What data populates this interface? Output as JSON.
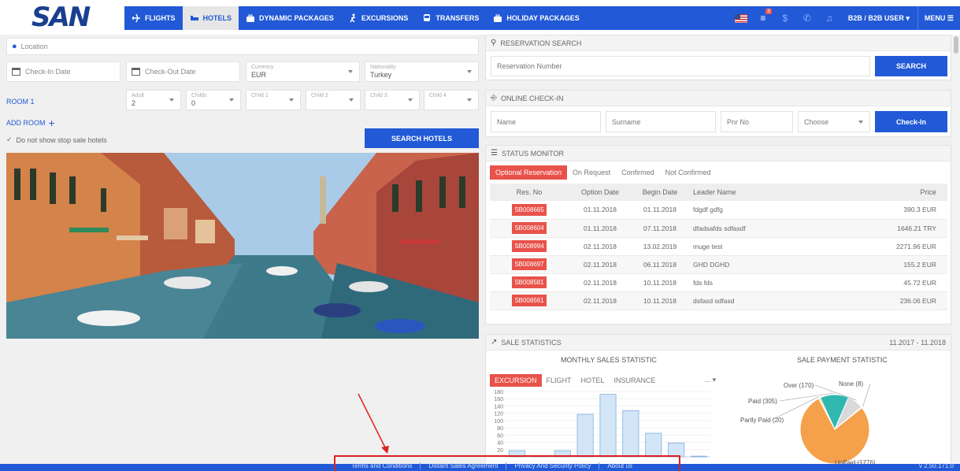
{
  "brand": "SAN",
  "nav": {
    "items": [
      {
        "label": "FLIGHTS",
        "icon": "plane-icon"
      },
      {
        "label": "HOTELS",
        "icon": "bed-icon"
      },
      {
        "label": "DYNAMIC PACKAGES",
        "icon": "suitcase-icon"
      },
      {
        "label": "EXCURSIONS",
        "icon": "walker-icon"
      },
      {
        "label": "TRANSFERS",
        "icon": "bus-icon"
      },
      {
        "label": "HOLIDAY PACKAGES",
        "icon": "suitcase-icon"
      }
    ],
    "active": "HOTELS",
    "user": "B2B / B2B USER",
    "menu": "MENU",
    "cart_count": "3"
  },
  "search": {
    "location_placeholder": "Location",
    "checkin_placeholder": "Check-In Date",
    "checkout_placeholder": "Check-Out Date",
    "currency_label": "Currency",
    "currency_value": "EUR",
    "nationality_label": "Nationality",
    "nationality_value": "Turkey",
    "room_label": "ROOM 1",
    "adult_label": "Adult",
    "adult_value": "2",
    "childs_label": "Childs",
    "childs_value": "0",
    "child1": "Child 1",
    "child2": "Child 2",
    "child3": "Child 3",
    "child4": "Child 4",
    "add_room": "ADD ROOM",
    "stop_sale": "Do not show stop sale hotels",
    "button": "SEARCH HOTELS"
  },
  "reservation_search": {
    "title": "RESERVATION SEARCH",
    "placeholder": "Reservation Number",
    "button": "SEARCH"
  },
  "online_checkin": {
    "title": "ONLINE CHECK-IN",
    "name": "Name",
    "surname": "Surname",
    "pnr": "Pnr No",
    "choose": "Choose",
    "button": "Check-In"
  },
  "status_monitor": {
    "title": "STATUS MONITOR",
    "tabs": [
      "Optional Reservation",
      "On Request",
      "Confirmed",
      "Not Confirmed"
    ],
    "headers": [
      "Res. No",
      "Option Date",
      "Begin Date",
      "Leader Name",
      "Price"
    ],
    "rows": [
      {
        "res": "SB008665",
        "option": "01.11.2018",
        "begin": "01.11.2018",
        "leader": "fdgdf gdfg",
        "price": "390.3 EUR"
      },
      {
        "res": "SB008604",
        "option": "01.11.2018",
        "begin": "07.11.2018",
        "leader": "dfadsafds sdfasdf",
        "price": "1646.21 TRY"
      },
      {
        "res": "SB008994",
        "option": "02.11.2018",
        "begin": "13.02.2019",
        "leader": "muge test",
        "price": "2271.96 EUR"
      },
      {
        "res": "SB008697",
        "option": "02.11.2018",
        "begin": "06.11.2018",
        "leader": "GHD DGHD",
        "price": "155.2 EUR"
      },
      {
        "res": "SB008581",
        "option": "02.11.2018",
        "begin": "10.11.2018",
        "leader": "fds fds",
        "price": "45.72 EUR"
      },
      {
        "res": "SB008561",
        "option": "02.11.2018",
        "begin": "10.11.2018",
        "leader": "dsfasd sdfasd",
        "price": "236.06 EUR"
      }
    ]
  },
  "sale_statistics": {
    "title": "SALE STATISTICS",
    "range": "11.2017 - 11.2018",
    "monthly_title": "MONTHLY SALES STATISTIC",
    "payment_title": "SALE PAYMENT STATISTIC",
    "chart_tabs": [
      "EXCURSION",
      "FLIGHT",
      "HOTEL",
      "INSURANCE"
    ],
    "more": "..."
  },
  "chart_data": [
    {
      "type": "bar",
      "title": "MONTHLY SALES STATISTIC",
      "ylim": [
        0,
        180
      ],
      "yticks": [
        20,
        40,
        60,
        80,
        100,
        120,
        140,
        160,
        180
      ],
      "values": [
        17,
        2,
        17,
        117,
        172,
        127,
        65,
        38,
        2
      ]
    },
    {
      "type": "pie",
      "title": "SALE PAYMENT STATISTIC",
      "labels": [
        "UnPaid (1776)",
        "Partly Paid (20)",
        "Paid (305)",
        "Over (170)",
        "None (8)"
      ],
      "values": [
        1776,
        20,
        305,
        170,
        8
      ],
      "colors": [
        "#f5a04a",
        "#ffd97a",
        "#2fb7b0",
        "#d9d9d9",
        "#8a8a8a"
      ]
    }
  ],
  "footer": {
    "links": [
      "Terms and Conditions",
      "Distant Sales Agreement",
      "Privacy And Security Policy",
      "About us"
    ],
    "version": "v 2.50.171.0"
  },
  "colors": {
    "primary": "#2159d6",
    "accent": "#e8524a"
  }
}
